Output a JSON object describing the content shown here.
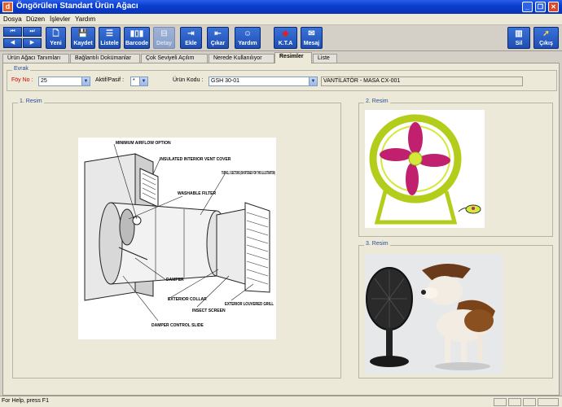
{
  "window": {
    "title": "Öngörülen Standart Ürün Ağacı",
    "icon_letter": "d",
    "controls": [
      "_",
      "❐",
      "✕"
    ]
  },
  "menu": [
    {
      "label": "Dosya",
      "key": "D"
    },
    {
      "label": "Düzen",
      "key": "D"
    },
    {
      "label": "İşlevler",
      "key": "İ"
    },
    {
      "label": "Yardım",
      "key": "Y"
    }
  ],
  "toolbar": {
    "nav": [
      "⏮",
      "⏭",
      "◀",
      "▶"
    ],
    "buttons": [
      {
        "label": "Yeni",
        "icon": "new-document-icon",
        "glyph": "🗋",
        "enabled": true
      },
      {
        "label": "Kaydet",
        "icon": "save-icon",
        "glyph": "💾",
        "enabled": true
      },
      {
        "label": "Listele",
        "icon": "list-icon",
        "glyph": "☰",
        "enabled": true
      },
      {
        "label": "Barcode",
        "icon": "barcode-icon",
        "glyph": "▮▯▮",
        "enabled": true
      },
      {
        "label": "Detay",
        "icon": "detail-icon",
        "glyph": "⊟",
        "enabled": false
      },
      {
        "label": "Ekle",
        "icon": "add-icon",
        "glyph": "⇥",
        "enabled": true
      },
      {
        "label": "Çıkar",
        "icon": "remove-icon",
        "glyph": "⇤",
        "enabled": true
      },
      {
        "label": "Yardım",
        "icon": "help-smiley-icon",
        "glyph": "☺",
        "enabled": true
      },
      {
        "label": "K.T.A",
        "icon": "kta-icon",
        "glyph": "◆",
        "enabled": true
      },
      {
        "label": "Mesaj",
        "icon": "message-icon",
        "glyph": "✉",
        "enabled": true
      },
      {
        "label": "Sil",
        "icon": "delete-icon",
        "glyph": "▥",
        "enabled": true
      },
      {
        "label": "Çıkış",
        "icon": "exit-icon",
        "glyph": "➚",
        "enabled": true
      }
    ]
  },
  "tabs": [
    {
      "label": "Ürün Ağacı Tanımları",
      "active": false
    },
    {
      "label": "Bağlantılı Dokümanlar",
      "active": false
    },
    {
      "label": "Çok Seviyeli Açılım",
      "active": false
    },
    {
      "label": "Nerede Kullanılıyor",
      "active": false
    },
    {
      "label": "Resimler",
      "active": true
    },
    {
      "label": "Liste",
      "active": false
    }
  ],
  "evrak": {
    "group_title": "Evrak",
    "foy_no_label": "Föy No :",
    "foy_no_value": "25",
    "aktif_label": "Aktif/Pasif :",
    "aktif_value": "*",
    "urun_kodu_label": "Ürün Kodu :",
    "urun_kodu_value": "GSH 30-01",
    "urun_adi_value": "VANTİLATÖR - MASA CX-001"
  },
  "images": {
    "resim1_title": "1. Resim",
    "resim2_title": "2. Resim",
    "resim3_title": "3. Resim",
    "diagram_labels": {
      "min_airflow": "MINIMUM AIRFLOW OPTION",
      "insulated_cover": "INSULATED INTERIOR VENT COVER",
      "tubing": "TUBING, 2 SECTIONS (SHORTENED FOR THIS ILLUSTRATION)",
      "washable_filter": "WASHABLE FILTER",
      "damper": "DAMPER",
      "exterior_collar": "EXTERIOR COLLAR",
      "exterior_louvered": "EXTERIOR LOUVERED GRILL",
      "insect_screen": "INSECT SCREEN",
      "damper_slide": "DAMPER CONTROL SLIDE"
    }
  },
  "status": {
    "text": "For Help, press F1"
  },
  "colors": {
    "title_bar": "#0a3fd0",
    "toolbar_button": "#1f4fb4",
    "group_title": "#2a4a9a",
    "foy_label": "#cc0000",
    "fan_body": "#c8e020",
    "fan_blades": "#c0206e"
  }
}
